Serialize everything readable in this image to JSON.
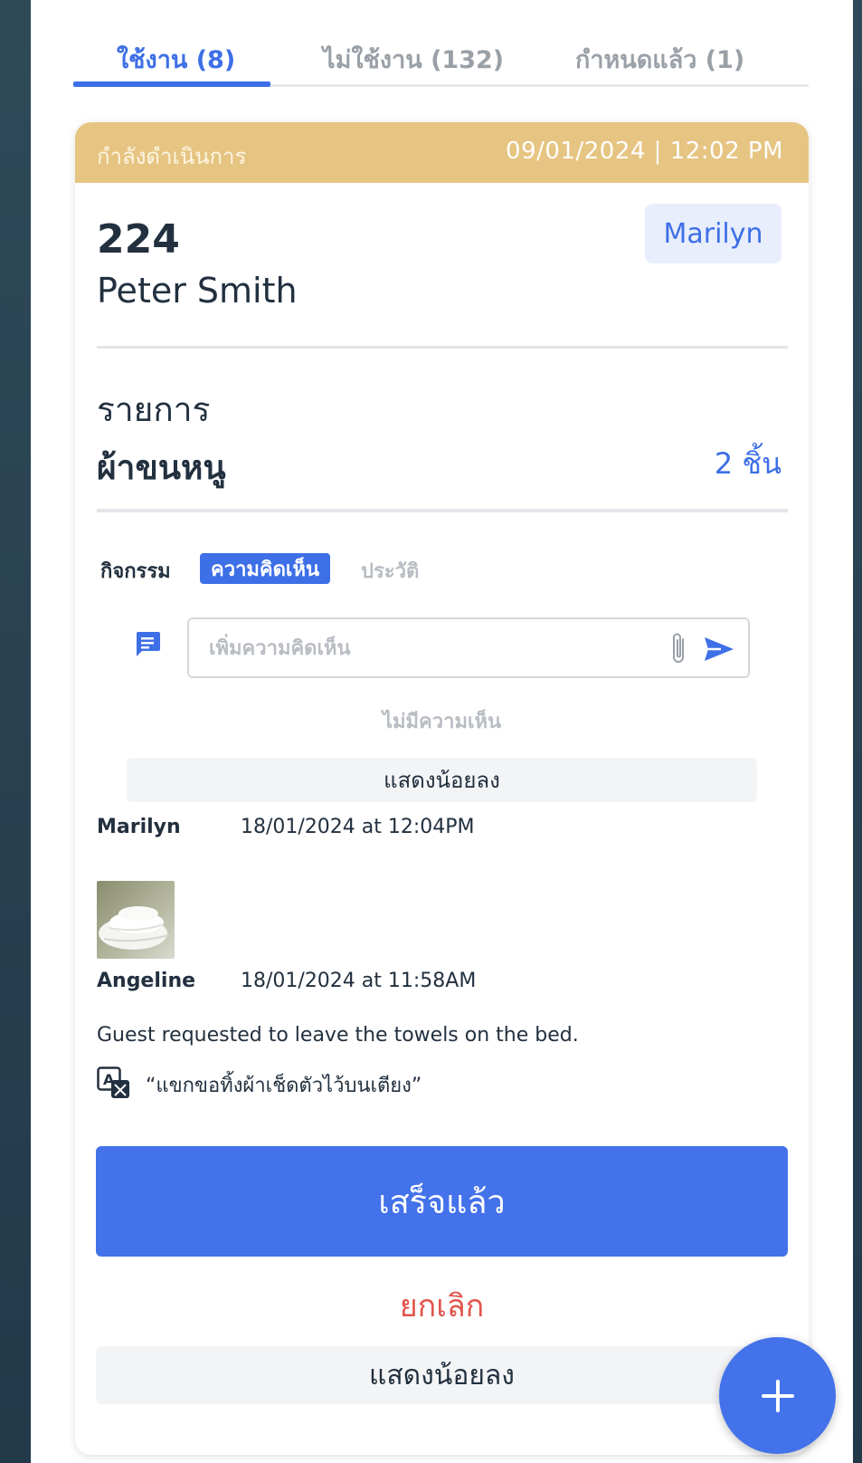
{
  "tabs": [
    {
      "label": "ใช้งาน (8)",
      "active": true
    },
    {
      "label": "ไม่ใช้งาน (132)",
      "active": false
    },
    {
      "label": "กำหนดแล้ว (1)",
      "active": false
    }
  ],
  "card": {
    "status": "กำลังดำเนินการ",
    "datetime": "09/01/2024 | 12:02 PM",
    "room": "224",
    "guest": "Peter Smith",
    "assignee": "Marilyn",
    "items_label": "รายการ",
    "item_name": "ผ้าขนหนู",
    "item_qty": "2 ชิ้น"
  },
  "activity": {
    "label": "กิจกรรม",
    "tab_comments": "ความคิดเห็น",
    "tab_history": "ประวัติ",
    "input_placeholder": "เพิ่มความคิดเห็น",
    "no_comments": "ไม่มีความเห็น",
    "show_less": "แสดงน้อยลง"
  },
  "comments": [
    {
      "author": "Marilyn",
      "time": "18/01/2024 at 12:04PM",
      "has_image": true
    },
    {
      "author": "Angeline",
      "time": "18/01/2024 at 11:58AM",
      "text": "Guest requested to leave the towels on the bed.",
      "translation": "“แขกขอทิ้งผ้าเช็ดตัวไว้บนเตียง”"
    }
  ],
  "actions": {
    "done": "เสร็จแล้ว",
    "cancel": "ยกเลิก",
    "show_less": "แสดงน้อยลง"
  },
  "icons": {
    "comment": "comment-icon",
    "attach": "paperclip-icon",
    "send": "send-icon",
    "translate": "translate-icon",
    "add": "plus-icon"
  },
  "colors": {
    "accent": "#4372ea",
    "status_header": "#e6c482",
    "cancel": "#e0554b"
  }
}
